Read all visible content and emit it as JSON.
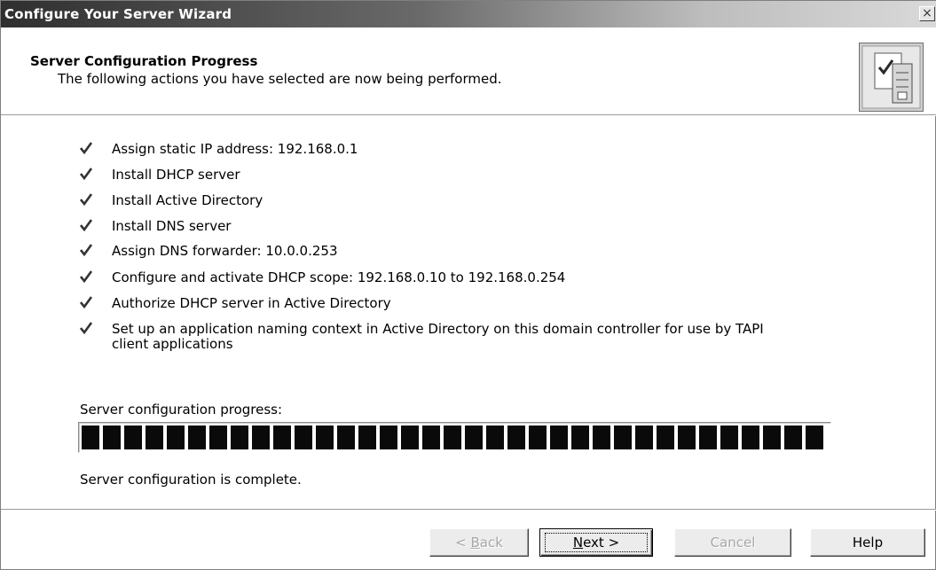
{
  "window": {
    "title": "Configure Your Server Wizard",
    "close_glyph": "×"
  },
  "header": {
    "heading": "Server Configuration Progress",
    "subheading": "The following actions you have selected are now being performed.",
    "icon": "server-checklist-icon"
  },
  "actions": [
    {
      "text": "Assign static IP address: 192.168.0.1",
      "icon": "check-icon"
    },
    {
      "text": "Install DHCP server",
      "icon": "check-icon"
    },
    {
      "text": "Install Active Directory",
      "icon": "check-icon"
    },
    {
      "text": "Install DNS server",
      "icon": "check-icon"
    },
    {
      "text": "Assign DNS forwarder: 10.0.0.253",
      "icon": "check-icon"
    },
    {
      "text": "Configure and activate DHCP scope: 192.168.0.10 to 192.168.0.254",
      "icon": "check-icon"
    },
    {
      "text": "Authorize DHCP server in Active Directory",
      "icon": "check-icon"
    },
    {
      "text": "Set up an application naming context in Active Directory on this domain controller for use by TAPI client applications",
      "icon": "check-icon"
    }
  ],
  "progress": {
    "label": "Server configuration progress:",
    "percent": 100,
    "status": "Server configuration is complete."
  },
  "buttons": {
    "back": {
      "pre": "< ",
      "acc": "B",
      "post": "ack",
      "enabled": false
    },
    "next": {
      "pre": "",
      "acc": "N",
      "post": "ext >",
      "enabled": true
    },
    "cancel": {
      "label": "Cancel",
      "enabled": false
    },
    "help": {
      "label": "Help",
      "enabled": true
    }
  },
  "colors": {
    "progress_fill": "#0a0a0a",
    "check": "#333333"
  }
}
